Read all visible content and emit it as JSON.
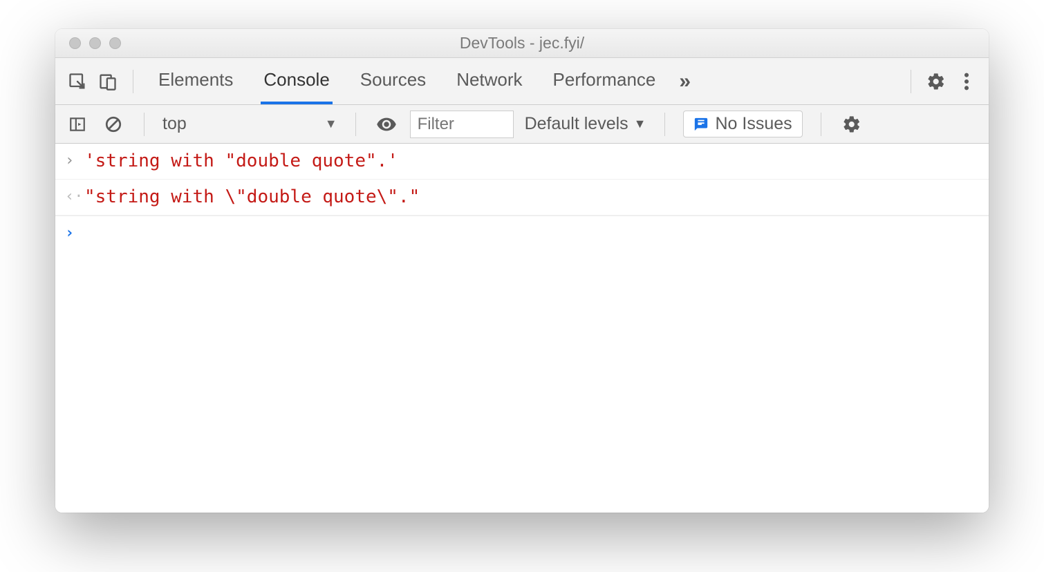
{
  "window": {
    "title": "DevTools - jec.fyi/"
  },
  "tabs": {
    "items": [
      "Elements",
      "Console",
      "Sources",
      "Network",
      "Performance"
    ],
    "active_index": 1
  },
  "toolbar": {
    "context": "top",
    "filter_placeholder": "Filter",
    "levels_label": "Default levels",
    "issues_label": "No Issues"
  },
  "console": {
    "rows": [
      {
        "kind": "input",
        "text": "'string with \"double quote\".'"
      },
      {
        "kind": "output",
        "text": "\"string with \\\"double quote\\\".\""
      }
    ]
  }
}
